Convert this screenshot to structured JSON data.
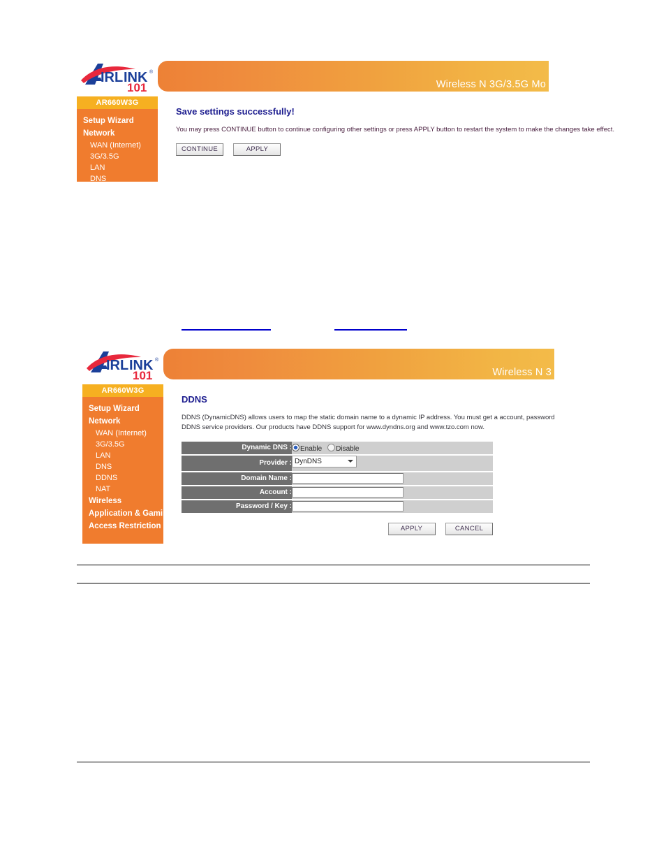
{
  "document": {
    "panels": [
      {
        "id": "save-settings",
        "header_title": "Wireless N 3G/3.5G Mo",
        "model": "AR660W3G",
        "nav": [
          {
            "label": "Setup Wizard",
            "level": "top"
          },
          {
            "label": "Network",
            "level": "top"
          },
          {
            "label": "WAN (Internet)",
            "level": "sub"
          },
          {
            "label": "3G/3.5G",
            "level": "sub"
          },
          {
            "label": "LAN",
            "level": "sub"
          },
          {
            "label": "DNS",
            "level": "sub"
          }
        ],
        "content": {
          "title": "Save settings successfully!",
          "description": "You may press CONTINUE button to continue configuring other settings or press APPLY button to restart the system to make the changes take effect.",
          "buttons": [
            {
              "label": "CONTINUE"
            },
            {
              "label": "APPLY"
            }
          ]
        }
      },
      {
        "id": "ddns",
        "header_title": "Wireless N 3",
        "model": "AR660W3G",
        "nav": [
          {
            "label": "Setup Wizard",
            "level": "top"
          },
          {
            "label": "Network",
            "level": "top"
          },
          {
            "label": "WAN (Internet)",
            "level": "sub"
          },
          {
            "label": "3G/3.5G",
            "level": "sub"
          },
          {
            "label": "LAN",
            "level": "sub"
          },
          {
            "label": "DNS",
            "level": "sub"
          },
          {
            "label": "DDNS",
            "level": "sub"
          },
          {
            "label": "NAT",
            "level": "sub"
          },
          {
            "label": "Wireless",
            "level": "top"
          },
          {
            "label": "Application & Gaming",
            "level": "top"
          },
          {
            "label": "Access Restriction",
            "level": "top"
          }
        ],
        "content": {
          "title": "DDNS",
          "description_line1": "DDNS (DynamicDNS) allows users to map the static domain name to a dynamic IP address. You must get a account, password",
          "description_line2": "DDNS service providers. Our products have DDNS support for www.dyndns.org and www.tzo.com now.",
          "fields": {
            "dynamic_dns": {
              "label": "Dynamic DNS :",
              "options": [
                {
                  "label": "Enable",
                  "selected": true
                },
                {
                  "label": "Disable",
                  "selected": false
                }
              ]
            },
            "provider": {
              "label": "Provider :",
              "value": "DynDNS"
            },
            "domain_name": {
              "label": "Domain Name :",
              "value": ""
            },
            "account": {
              "label": "Account :",
              "value": ""
            },
            "password_key": {
              "label": "Password / Key :",
              "value": ""
            }
          },
          "buttons": [
            {
              "label": "APPLY"
            },
            {
              "label": "CANCEL"
            }
          ]
        }
      }
    ],
    "colors": {
      "sidebar_orange": "#f07c2e",
      "model_amber": "#f6b021",
      "header_gradient_start": "#ed8136",
      "header_gradient_end": "#f3bb49",
      "title_blue": "#1d1d8f",
      "label_gray": "#6f6f6f",
      "value_gray": "#cfcfcf",
      "link_blue": "#0000cc"
    }
  }
}
